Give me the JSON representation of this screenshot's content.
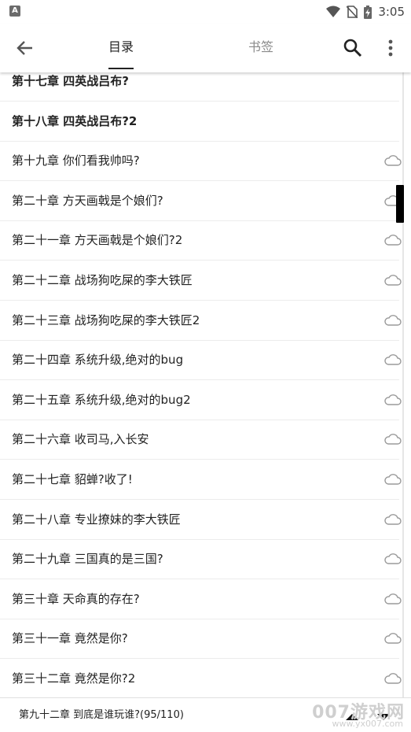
{
  "status_bar": {
    "time": "3:05"
  },
  "toolbar": {
    "tab_toc": "目录",
    "tab_bookmarks": "书签"
  },
  "chapters": [
    {
      "title": "第十七章 四英战吕布?",
      "bold": true,
      "cloud": false
    },
    {
      "title": "第十八章 四英战吕布?2",
      "bold": true,
      "cloud": false
    },
    {
      "title": "第十九章 你们看我帅吗?",
      "bold": false,
      "cloud": true
    },
    {
      "title": "第二十章 方天画戟是个娘们?",
      "bold": false,
      "cloud": true
    },
    {
      "title": "第二十一章 方天画戟是个娘们?2",
      "bold": false,
      "cloud": true
    },
    {
      "title": "第二十二章 战场狗吃屎的李大铁匠",
      "bold": false,
      "cloud": true
    },
    {
      "title": "第二十三章 战场狗吃屎的李大铁匠2",
      "bold": false,
      "cloud": true
    },
    {
      "title": "第二十四章 系统升级,绝对的bug",
      "bold": false,
      "cloud": true
    },
    {
      "title": "第二十五章 系统升级,绝对的bug2",
      "bold": false,
      "cloud": true
    },
    {
      "title": "第二十六章 收司马,入长安",
      "bold": false,
      "cloud": true
    },
    {
      "title": "第二十七章 貂蝉?收了!",
      "bold": false,
      "cloud": true
    },
    {
      "title": "第二十八章 专业撩妹的李大铁匠",
      "bold": false,
      "cloud": true
    },
    {
      "title": "第二十九章 三国真的是三国?",
      "bold": false,
      "cloud": true
    },
    {
      "title": "第三十章 天命真的存在?",
      "bold": false,
      "cloud": true
    },
    {
      "title": "第三十一章 竟然是你?",
      "bold": false,
      "cloud": true
    },
    {
      "title": "第三十二章 竟然是你?2",
      "bold": false,
      "cloud": true
    }
  ],
  "current_reading": "第九十二章 到底是谁玩谁?(95/110)",
  "watermark": {
    "main": "007游戏网",
    "sub": "www.yx007.com"
  },
  "icons": {
    "back": "arrow-back-icon",
    "search": "search-icon",
    "more": "more-vert-icon",
    "cloud": "cloud-icon"
  }
}
